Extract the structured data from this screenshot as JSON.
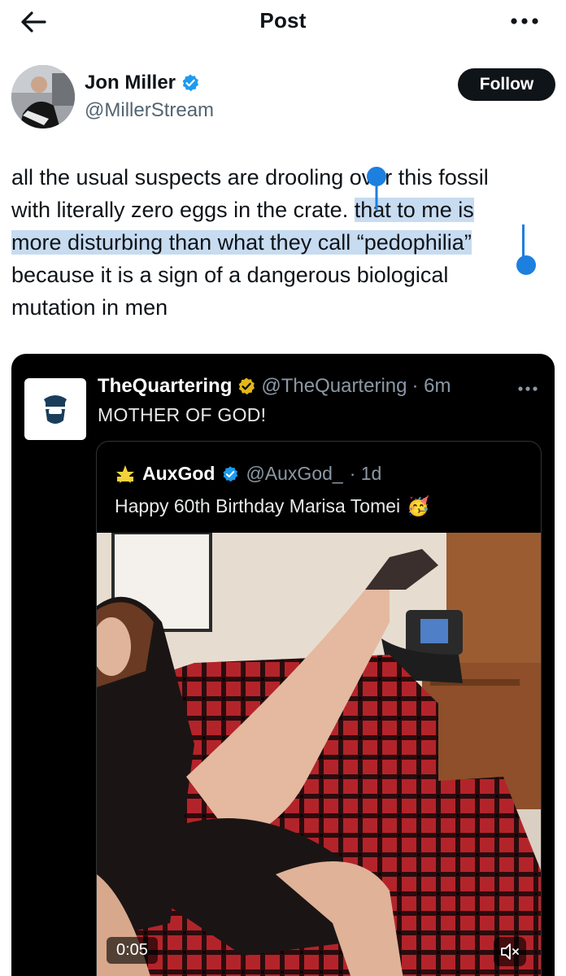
{
  "header": {
    "title": "Post",
    "back_icon": "arrow-left-icon",
    "more_icon": "more-horizontal-icon"
  },
  "author": {
    "name": "Jon Miller",
    "handle": "@MillerStream",
    "verified_icon": "verified-badge-icon",
    "follow_label": "Follow"
  },
  "tweet": {
    "lines": [
      {
        "plain": "all the usual suspects are drooling over this fossil",
        "highlight": ""
      },
      {
        "plain": "with literally zero eggs in the crate. ",
        "highlight": "that to me is"
      },
      {
        "plain": "",
        "highlight": "more disturbing than what they call “pedophilia”"
      },
      {
        "plain": "because it is a sign of a dangerous biological",
        "highlight": ""
      },
      {
        "plain": "mutation in men",
        "highlight": ""
      }
    ]
  },
  "quote": {
    "name": "TheQuartering",
    "handle": "@TheQuartering",
    "time": "· 6m",
    "text": "MOTHER OF GOD!",
    "badge_icon": "gold-verified-badge-icon",
    "more_icon": "more-horizontal-icon",
    "inner": {
      "name": "AuxGod",
      "handle": "@AuxGod_",
      "time": "· 1d",
      "text": "Happy 60th Birthday Marisa Tomei",
      "emoji": "🥳",
      "video": {
        "duration": "0:05",
        "mute_icon": "speaker-muted-icon"
      }
    }
  },
  "colors": {
    "accent": "#1d9bf0",
    "selection": "#c7dbf1",
    "gold_badge": "#e2b719"
  }
}
